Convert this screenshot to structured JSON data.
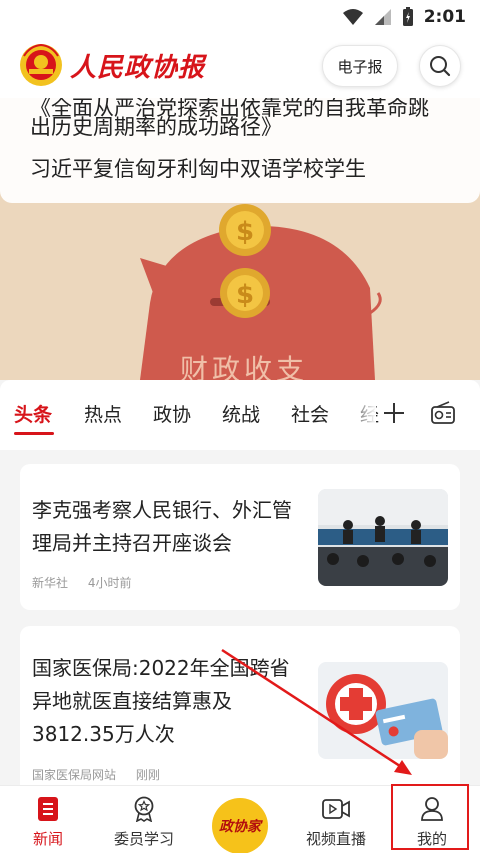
{
  "status_bar": {
    "time": "2:01"
  },
  "header": {
    "logo_text": "人民政协报",
    "epaper_label": "电子报",
    "search_icon": "search-icon"
  },
  "hero": {
    "headline_partial": "《全面从严治党探索出依靠党的自我革命跳",
    "headline_line2": "出历史周期率的成功路径》",
    "headline_line3": "习近平复信匈牙利匈中双语学校学生",
    "image_caption": "财政收支"
  },
  "tabs": {
    "items": [
      "头条",
      "热点",
      "政协",
      "统战",
      "社会",
      "经"
    ],
    "active": "头条",
    "add_icon": "plus-icon",
    "radio_icon": "radio-icon"
  },
  "news": [
    {
      "title": "李克强考察人民银行、外汇管理局并主持召开座谈会",
      "source": "新华社",
      "time": "4小时前"
    },
    {
      "title": "国家医保局:2022年全国跨省异地就医直接结算惠及3812.35万人次",
      "source": "国家医保局网站",
      "time": "刚刚"
    }
  ],
  "bottom_nav": {
    "items": [
      {
        "label": "新闻",
        "icon": "news-icon"
      },
      {
        "label": "委员学习",
        "icon": "medal-icon"
      },
      {
        "label": "政协家",
        "icon": "zhengxiejia-badge"
      },
      {
        "label": "视频直播",
        "icon": "video-icon"
      },
      {
        "label": "我的",
        "icon": "user-icon"
      }
    ],
    "active": "新闻"
  },
  "colors": {
    "brand_red": "#d7141a",
    "badge_yellow": "#f6c21a",
    "annotation_red": "#e21a1a"
  }
}
